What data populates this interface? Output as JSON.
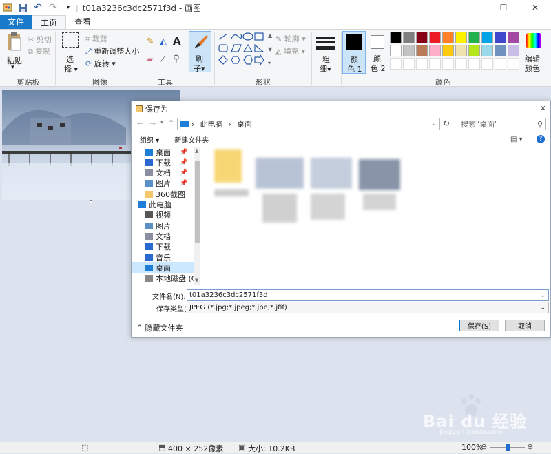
{
  "window": {
    "title": "t01a3236c3dc2571f3d - 画图",
    "controls": {
      "minimize": "—",
      "maximize": "☐",
      "close": "✕"
    }
  },
  "tabs": [
    {
      "label": "文件"
    },
    {
      "label": "主页"
    },
    {
      "label": "查看"
    }
  ],
  "ribbon": {
    "clipboard": {
      "paste": "粘贴",
      "cut": "剪切",
      "copy": "复制",
      "label": "剪贴板"
    },
    "image": {
      "select_1": "选",
      "select_2": "择",
      "crop": "裁剪",
      "resize": "重新调整大小",
      "rotate": "旋转",
      "label": "图像"
    },
    "tools": {
      "label": "工具"
    },
    "brush": {
      "line1": "刷",
      "line2": "子"
    },
    "shapes": {
      "outline": "轮廓",
      "fill": "填充",
      "label": "形状"
    },
    "size": {
      "line1": "粗",
      "line2": "细"
    },
    "color1": {
      "line1": "颜",
      "line2": "色 1"
    },
    "color2": {
      "line1": "颜",
      "line2": "色 2"
    },
    "colors": {
      "label": "颜色"
    },
    "edit_colors": {
      "line1": "编辑",
      "line2": "颜色"
    },
    "palette_row1": [
      "#000000",
      "#7f7f7f",
      "#880015",
      "#ed1c24",
      "#ff7f27",
      "#fff200",
      "#22b14c",
      "#00a2e8",
      "#3f48cc",
      "#a349a4"
    ],
    "palette_row2": [
      "#ffffff",
      "#c3c3c3",
      "#b97a57",
      "#ffaec9",
      "#ffc90e",
      "#efe4b0",
      "#b5e61d",
      "#99d9ea",
      "#7092be",
      "#c8bfe7"
    ]
  },
  "dialog": {
    "title": "保存为",
    "close": "✕",
    "breadcrumb": {
      "computer": "此电脑",
      "arrow": "›",
      "desktop": "桌面"
    },
    "search_placeholder": "搜索\"桌面\"",
    "toolbar": {
      "organize": "组织 ▾",
      "new_folder": "新建文件夹"
    },
    "nav": [
      {
        "label": "桌面",
        "pin": true
      },
      {
        "label": "下载",
        "pin": true
      },
      {
        "label": "文档",
        "pin": true
      },
      {
        "label": "图片",
        "pin": true
      },
      {
        "label": "360截图",
        "pin": false
      },
      {
        "label": "此电脑",
        "pin": false
      },
      {
        "label": "视频",
        "pin": false
      },
      {
        "label": "图片",
        "pin": false
      },
      {
        "label": "文档",
        "pin": false
      },
      {
        "label": "下载",
        "pin": false
      },
      {
        "label": "音乐",
        "pin": false
      },
      {
        "label": "桌面",
        "pin": false
      },
      {
        "label": "本地磁盘 (C",
        "pin": false
      }
    ],
    "filename_label": "文件名(N):",
    "filename_value": "t01a3236c3dc2571f3d",
    "filetype_label": "保存类型(T):",
    "filetype_value": "JPEG (*.jpg;*.jpeg;*.jpe;*.jfif)",
    "hide_folders": "隐藏文件夹",
    "save": "保存(S)",
    "cancel": "取消"
  },
  "status": {
    "dimensions": "400 × 252像素",
    "size": "大小: 10.2KB",
    "zoom": "100%",
    "zoom_level": 0.5
  },
  "watermark": {
    "brand": "Bai du 经验",
    "url": "jingyan.baidu.com"
  }
}
